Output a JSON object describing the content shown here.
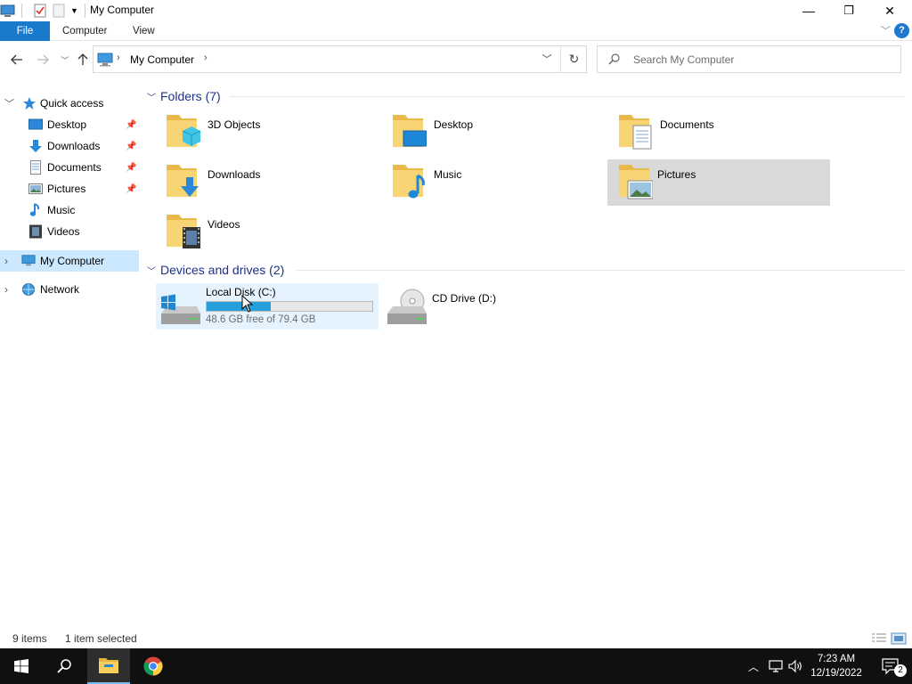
{
  "window": {
    "title": "My Computer",
    "controls": {
      "minimize": "—",
      "restore": "❐",
      "close": "✕"
    }
  },
  "ribbon": {
    "tabs": [
      "File",
      "Computer",
      "View"
    ],
    "help": "?"
  },
  "address": {
    "path": "My Computer",
    "search_placeholder": "Search My Computer"
  },
  "nav": {
    "quick_access": "Quick access",
    "items": [
      {
        "label": "Desktop",
        "pinned": true
      },
      {
        "label": "Downloads",
        "pinned": true
      },
      {
        "label": "Documents",
        "pinned": true
      },
      {
        "label": "Pictures",
        "pinned": true
      },
      {
        "label": "Music",
        "pinned": false
      },
      {
        "label": "Videos",
        "pinned": false
      }
    ],
    "my_computer": "My Computer",
    "network": "Network"
  },
  "folders": {
    "header": "Folders (7)",
    "items": [
      "3D Objects",
      "Desktop",
      "Documents",
      "Downloads",
      "Music",
      "Pictures",
      "Videos"
    ],
    "selected": "Pictures"
  },
  "drives": {
    "header": "Devices and drives (2)",
    "items": [
      {
        "name": "Local Disk (C:)",
        "free_text": "48.6 GB free of 79.4 GB",
        "used_fraction": 0.388
      },
      {
        "name": "CD Drive (D:)"
      }
    ]
  },
  "status": {
    "count": "9 items",
    "selection": "1 item selected"
  },
  "taskbar": {
    "time": "7:23 AM",
    "date": "12/19/2022",
    "notifications": "2"
  },
  "colors": {
    "accent": "#1979ca",
    "selection": "#cce8ff",
    "drive_bar": "#26a0da",
    "group_header": "#1e3287"
  }
}
